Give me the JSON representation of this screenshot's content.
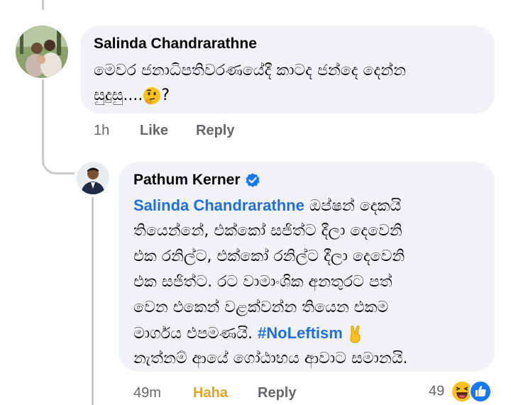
{
  "comment": {
    "author": "Salinda Chandrarathne",
    "text_line1": "මෙවර ජනාධිපතිවරණයේදී කාටද ජන්දෙ දෙන්න",
    "text_line2": "සුදුසු....",
    "text_after_emoji": "?",
    "emoji": "thinking-face",
    "time": "1h",
    "like_label": "Like",
    "reply_label": "Reply"
  },
  "reply": {
    "author": "Pathum Kerner",
    "verified": true,
    "mention": "Salinda Chandrarathne",
    "line1_after_mention": " ඔප්ෂන් දෙකයි",
    "line2": "තියෙන්නේ, එක්කෝ සජිත්ට දීලා දෙවෙනි",
    "line3": "එක රනිල්ට, එක්කෝ රනිල්ට දීලා දෙවෙනි",
    "line4": "එක සජිත්ට. රට වාමාංශික අනතුරට පත්",
    "line5": "වෙන එකෙන් වළක්වන්න තියෙන එකම",
    "line6_before_hashtag": "මාර්ගය එපමණයි. ",
    "hashtag": "#NoLeftism",
    "line6_emoji": "victory-hand",
    "line7": "නැත්නම් ආයේ ගෝඨාභය ආවාට සමානයි.",
    "time": "49m",
    "like_label": "Haha",
    "reply_label": "Reply",
    "reaction_count": "49",
    "reactions": [
      "haha",
      "like"
    ]
  },
  "colors": {
    "bubble": "#f0f2f5",
    "link": "#216fdb",
    "haha_active": "#e6a323",
    "meta": "#65676b",
    "verified": "#1877f2",
    "like_reaction": "#1877f2"
  }
}
